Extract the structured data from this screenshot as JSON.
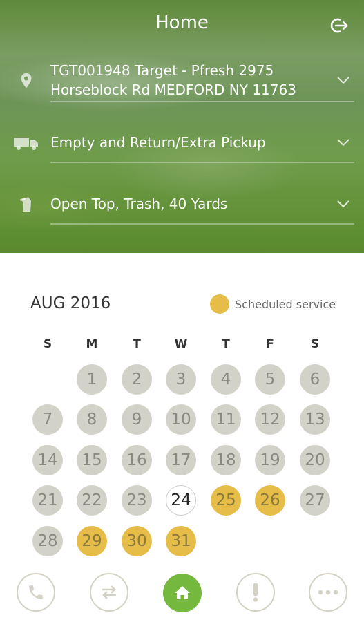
{
  "header": {
    "title": "Home",
    "logout_icon": "logout-icon"
  },
  "rows": [
    {
      "icon": "location-pin-icon",
      "lines": [
        "TGT001948 Target - Pfresh 2975",
        "Horseblock Rd  MEDFORD NY 11763"
      ]
    },
    {
      "icon": "truck-icon",
      "lines": [
        "Empty and Return/Extra Pickup"
      ]
    },
    {
      "icon": "dumpster-icon",
      "lines": [
        "Open Top, Trash, 40 Yards"
      ]
    }
  ],
  "calendar": {
    "month_label": "AUG 2016",
    "legend_label": "Scheduled service",
    "legend_color": "#e7bd4a",
    "weekdays": [
      "S",
      "M",
      "T",
      "W",
      "T",
      "F",
      "S"
    ],
    "weeks": [
      [
        "",
        "1",
        "2",
        "3",
        "4",
        "5",
        "6"
      ],
      [
        "7",
        "8",
        "9",
        "10",
        "11",
        "12",
        "13"
      ],
      [
        "14",
        "15",
        "16",
        "17",
        "18",
        "19",
        "20"
      ],
      [
        "21",
        "22",
        "23",
        "24",
        "25",
        "26",
        "27"
      ],
      [
        "28",
        "29",
        "30",
        "31",
        "",
        "",
        ""
      ]
    ],
    "today": "24",
    "scheduled_days": [
      "25",
      "26",
      "29",
      "30",
      "31"
    ]
  },
  "bottom_nav": [
    {
      "icon": "phone-icon"
    },
    {
      "icon": "swap-arrows-icon"
    },
    {
      "icon": "home-icon",
      "active": true
    },
    {
      "icon": "alert-icon"
    },
    {
      "icon": "more-icon"
    }
  ],
  "colors": {
    "accent_green": "#74b83e",
    "scheduled": "#e7bd4a",
    "past_day": "#d3d2c8"
  }
}
